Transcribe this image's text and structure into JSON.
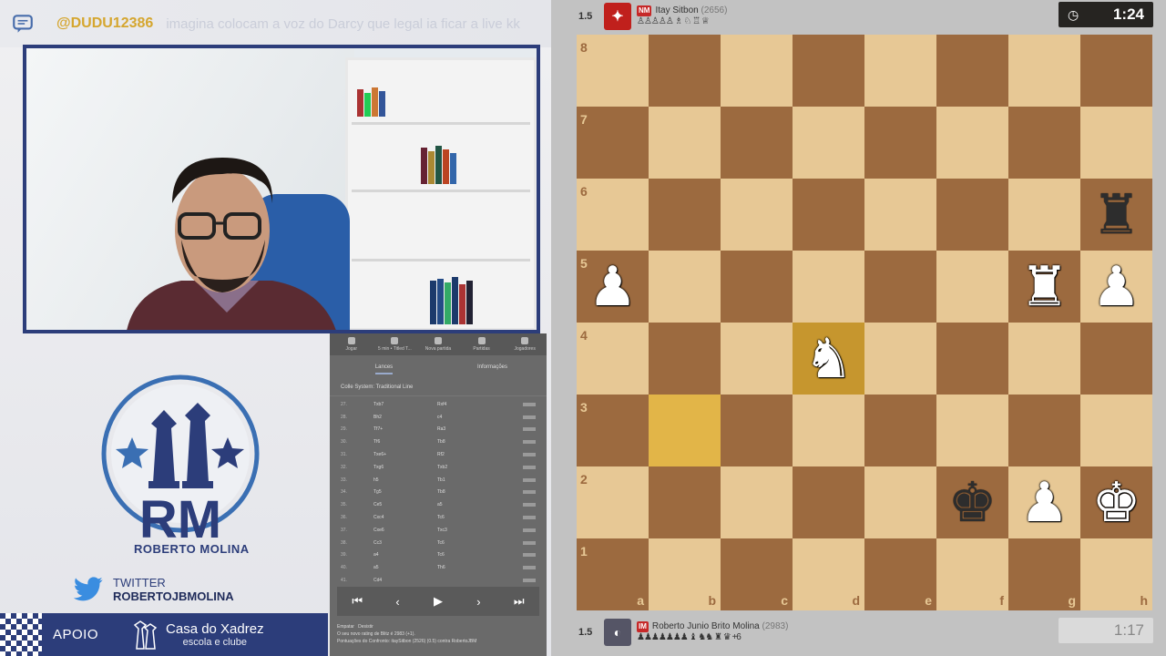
{
  "chat": {
    "user": "@DUDU12386",
    "message": "imagina colocam a voz do Darcy que legal ia ficar a live kk"
  },
  "branding": {
    "logo_text": "RM",
    "name": "ROBERTO MOLINA",
    "twitter_label": "TWITTER",
    "twitter_handle": "ROBERTOJBMOLINA",
    "apoio_label": "APOIO",
    "sponsor_name": "Casa do Xadrez",
    "sponsor_sub": "escola e clube",
    "brand_color": "#2c3d7a"
  },
  "analysis_panel": {
    "tabs": [
      "Jogar",
      "5 min • Titled T...",
      "Nova partida",
      "Partidas",
      "Jogadores"
    ],
    "subtabs": [
      "Lances",
      "Informações"
    ],
    "opening": "Colle System: Traditional Line",
    "moves": [
      {
        "n": "27.",
        "w": "Txb7",
        "b": "Rxf4"
      },
      {
        "n": "28.",
        "w": "Bh2",
        "b": "c4"
      },
      {
        "n": "29.",
        "w": "Tf7+",
        "b": "Ra3"
      },
      {
        "n": "30.",
        "w": "Tf6",
        "b": "Tb8"
      },
      {
        "n": "31.",
        "w": "Txe6+",
        "b": "Rf2"
      },
      {
        "n": "32.",
        "w": "Txg6",
        "b": "Txb2"
      },
      {
        "n": "33.",
        "w": "h5",
        "b": "Tb1"
      },
      {
        "n": "34.",
        "w": "Tg5",
        "b": "Tb8"
      },
      {
        "n": "35.",
        "w": "Ce5",
        "b": "a5"
      },
      {
        "n": "36.",
        "w": "Cxc4",
        "b": "Tc6"
      },
      {
        "n": "37.",
        "w": "Cxe6",
        "b": "Txc3"
      },
      {
        "n": "38.",
        "w": "Cc3",
        "b": "Tc6"
      },
      {
        "n": "39.",
        "w": "a4",
        "b": "Tc6"
      },
      {
        "n": "40.",
        "w": "a5",
        "b": "Th6"
      },
      {
        "n": "41.",
        "w": "Cd4",
        "b": ""
      }
    ],
    "controls": [
      "⏮",
      "‹",
      "▶",
      "›",
      "⏭"
    ],
    "footer": [
      "Empatar",
      "Desistir",
      "O seu novo rating de Blitz é 2983 (+1).",
      "Pontuações do Confronto: itaySitbon (2526) (0.5) contra RobertoJBM"
    ]
  },
  "game": {
    "top_player": {
      "title": "NM",
      "name": "Itay Sitbon",
      "elo": "(2656)",
      "score": "1.5",
      "captured": "♙♙♙♙♙ ♗ ♘ ♖ ♕",
      "clock": "1:24",
      "clock_icon": "clock-icon"
    },
    "bottom_player": {
      "title": "IM",
      "name": "Roberto Junio Brito Molina",
      "elo": "(2983)",
      "score": "1.5",
      "captured": "♟♟♟♟♟♟♟ ♝ ♞♞ ♜ ♛ +6",
      "clock": "1:17"
    },
    "rank_labels": [
      "8",
      "7",
      "6",
      "5",
      "4",
      "3",
      "2",
      "1"
    ],
    "file_labels": [
      "a",
      "b",
      "c",
      "d",
      "e",
      "f",
      "g",
      "h"
    ],
    "pieces": [
      {
        "sq": "h6",
        "glyph": "♜",
        "color": "black"
      },
      {
        "sq": "a5",
        "glyph": "♟",
        "color": "white"
      },
      {
        "sq": "g5",
        "glyph": "♜",
        "color": "white"
      },
      {
        "sq": "h5",
        "glyph": "♟",
        "color": "white"
      },
      {
        "sq": "d4",
        "glyph": "♞",
        "color": "white"
      },
      {
        "sq": "f2",
        "glyph": "♚",
        "color": "black"
      },
      {
        "sq": "g2",
        "glyph": "♟",
        "color": "white"
      },
      {
        "sq": "h2",
        "glyph": "♚",
        "color": "white"
      }
    ],
    "highlighted": [
      "b3",
      "d4"
    ]
  }
}
